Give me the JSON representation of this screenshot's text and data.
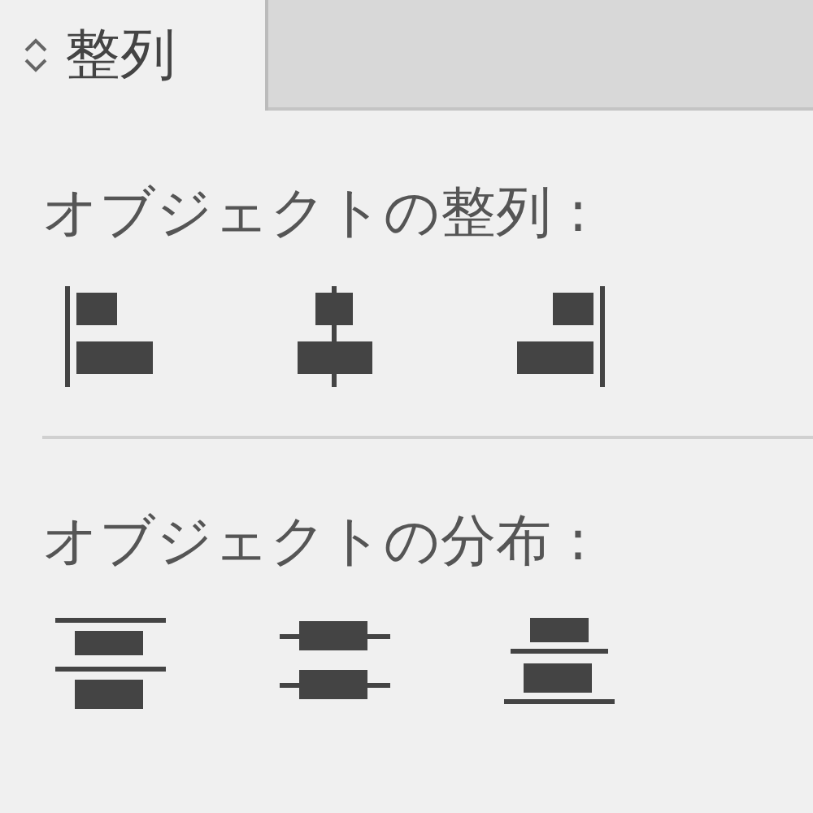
{
  "tab": {
    "label": "整列"
  },
  "sections": [
    {
      "heading": "オブジェクトの整列 :",
      "buttons": [
        {
          "kind": "align-left"
        },
        {
          "kind": "align-center"
        },
        {
          "kind": "align-right"
        }
      ]
    },
    {
      "heading": "オブジェクトの分布 :",
      "buttons": [
        {
          "kind": "dist-top"
        },
        {
          "kind": "dist-center"
        },
        {
          "kind": "dist-bottom"
        }
      ]
    }
  ]
}
